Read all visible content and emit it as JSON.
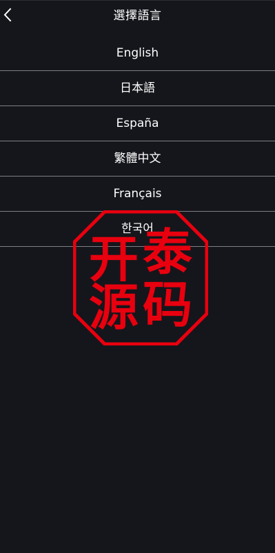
{
  "header": {
    "title": "選擇語言",
    "back_icon": "chevron-left-icon"
  },
  "languages": [
    {
      "label": "English"
    },
    {
      "label": "日本語"
    },
    {
      "label": "España"
    },
    {
      "label": "繁體中文"
    },
    {
      "label": "Français"
    },
    {
      "label": "한국어"
    }
  ],
  "watermark": {
    "text": [
      "开",
      "泰",
      "源",
      "码"
    ],
    "color": "#e8000f"
  },
  "colors": {
    "background": "#15161b",
    "text": "#ffffff",
    "divider": "#808086"
  }
}
